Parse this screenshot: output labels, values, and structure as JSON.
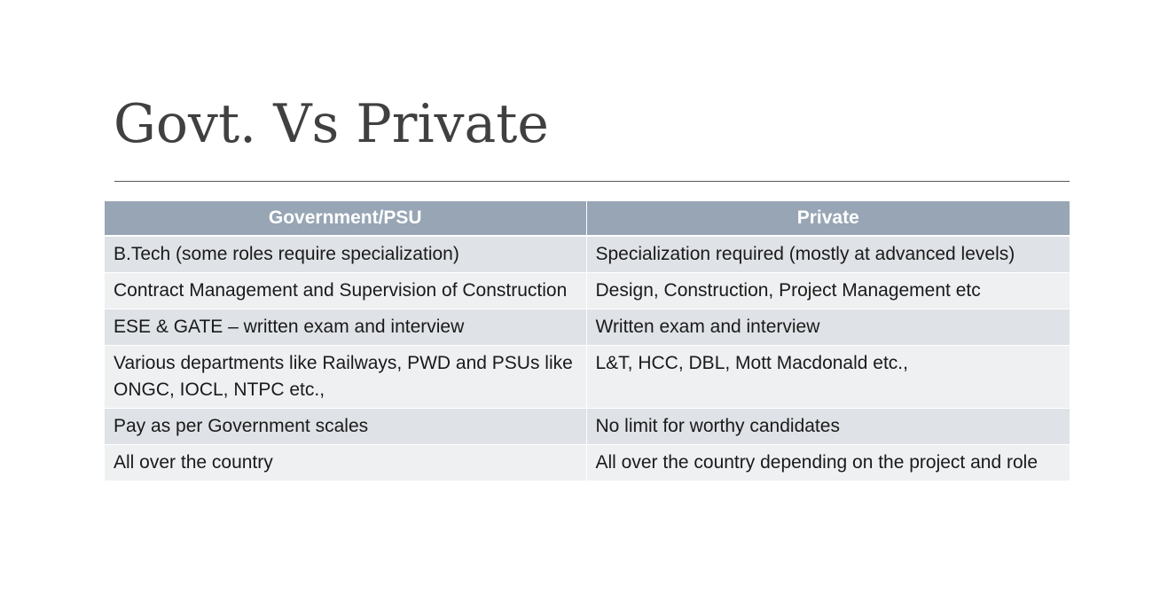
{
  "slide": {
    "title": "Govt. Vs Private"
  },
  "table": {
    "headers": [
      "Government/PSU",
      "Private"
    ],
    "rows": [
      [
        "B.Tech (some roles require specialization)",
        "Specialization required (mostly at advanced levels)"
      ],
      [
        "Contract Management and Supervision of Construction",
        "Design, Construction, Project Management etc"
      ],
      [
        "ESE & GATE – written exam and interview",
        "Written exam and interview"
      ],
      [
        "Various departments like Railways, PWD and PSUs like ONGC, IOCL, NTPC etc.,",
        "L&T, HCC, DBL, Mott Macdonald etc.,"
      ],
      [
        "Pay as per Government scales",
        "No limit for worthy candidates"
      ],
      [
        "All over the country",
        "All over the country depending on the project and role"
      ]
    ]
  },
  "colors": {
    "title_text": "#404040",
    "header_bg": "#97a5b5",
    "row_odd_bg": "#dfe2e6",
    "row_even_bg": "#eff0f2"
  }
}
